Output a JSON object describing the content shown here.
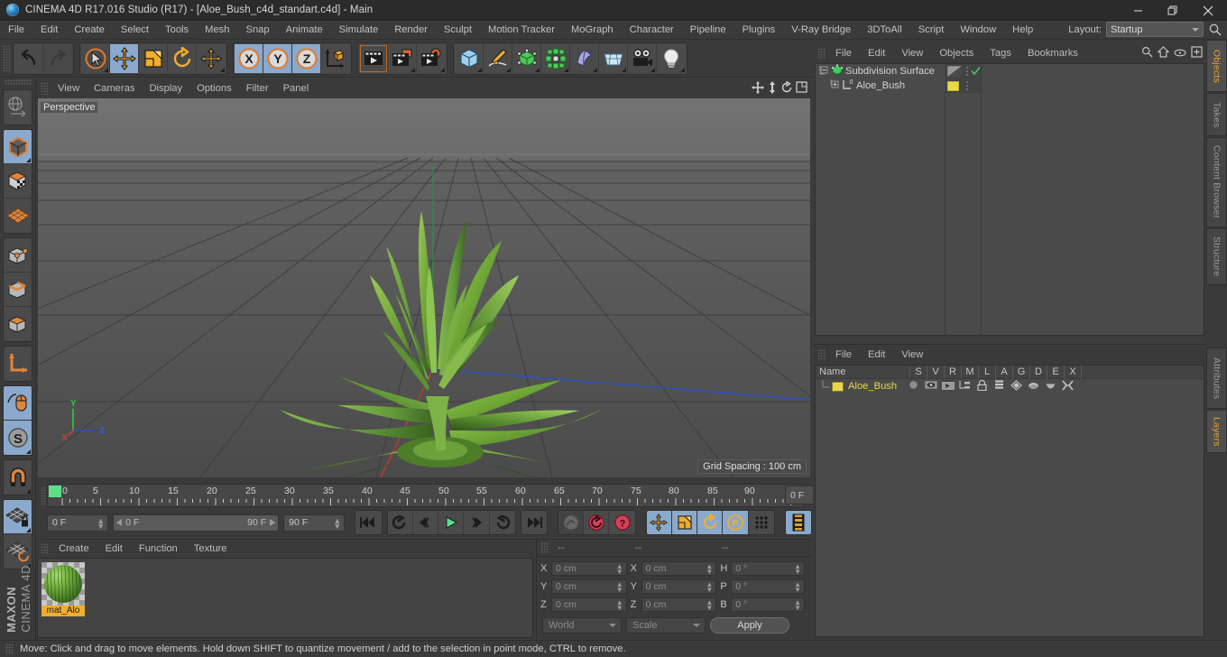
{
  "window": {
    "title": "CINEMA 4D R17.016 Studio (R17) - [Aloe_Bush_c4d_standart.c4d] - Main",
    "minimize_label": "—",
    "maximize_label": "❐",
    "close_label": "✕"
  },
  "menubar": {
    "items": [
      {
        "label": "File"
      },
      {
        "label": "Edit"
      },
      {
        "label": "Create"
      },
      {
        "label": "Select"
      },
      {
        "label": "Tools"
      },
      {
        "label": "Mesh"
      },
      {
        "label": "Snap"
      },
      {
        "label": "Animate"
      },
      {
        "label": "Simulate"
      },
      {
        "label": "Render"
      },
      {
        "label": "Sculpt"
      },
      {
        "label": "Motion Tracker"
      },
      {
        "label": "MoGraph"
      },
      {
        "label": "Character"
      },
      {
        "label": "Pipeline"
      },
      {
        "label": "Plugins"
      },
      {
        "label": "V-Ray Bridge"
      },
      {
        "label": "3DToAll"
      },
      {
        "label": "Script"
      },
      {
        "label": "Window"
      },
      {
        "label": "Help"
      }
    ],
    "layout_label": "Layout:",
    "layout_value": "Startup"
  },
  "toolbar": {
    "groups": [
      {
        "buttons": [
          {
            "name": "undo-icon",
            "selected": false
          },
          {
            "name": "redo-icon",
            "selected": false
          }
        ]
      },
      {
        "buttons": [
          {
            "name": "live-selection-icon",
            "selected": false
          },
          {
            "name": "move-tool-icon",
            "selected": true
          },
          {
            "name": "scale-tool-icon",
            "selected": false
          },
          {
            "name": "rotate-tool-icon",
            "selected": false
          },
          {
            "name": "move-axis-icon",
            "selected": false
          }
        ]
      },
      {
        "buttons": [
          {
            "name": "lock-x-axis-icon",
            "selected": true,
            "label": "X"
          },
          {
            "name": "lock-y-axis-icon",
            "selected": true,
            "label": "Y"
          },
          {
            "name": "lock-z-axis-icon",
            "selected": true,
            "label": "Z"
          },
          {
            "name": "world-object-coordinates-icon",
            "selected": false
          }
        ]
      },
      {
        "buttons": [
          {
            "name": "render-view-icon",
            "selected": false
          },
          {
            "name": "render-to-picture-viewer-icon",
            "selected": false
          },
          {
            "name": "render-settings-icon",
            "selected": false
          }
        ]
      },
      {
        "buttons": [
          {
            "name": "cube-primitive-icon",
            "selected": false
          },
          {
            "name": "spline-pen-icon",
            "selected": false
          },
          {
            "name": "generators-icon",
            "selected": false
          },
          {
            "name": "mograph-icon",
            "selected": false
          },
          {
            "name": "deformers-icon",
            "selected": false
          },
          {
            "name": "scene-floor-icon",
            "selected": false
          },
          {
            "name": "camera-icon",
            "selected": false
          },
          {
            "name": "light-icon",
            "selected": false
          }
        ]
      }
    ]
  },
  "leftbar": {
    "groups": [
      {
        "buttons": [
          {
            "name": "undo-view-icon",
            "selected": false
          }
        ]
      },
      {
        "buttons": [
          {
            "name": "model-mode-icon",
            "selected": true
          },
          {
            "name": "texture-mode-icon",
            "selected": false
          },
          {
            "name": "workplane-mode-icon",
            "selected": false
          }
        ]
      },
      {
        "buttons": [
          {
            "name": "points-mode-icon",
            "selected": false
          },
          {
            "name": "edges-mode-icon",
            "selected": false
          },
          {
            "name": "polygons-mode-icon",
            "selected": false
          }
        ]
      },
      {
        "buttons": [
          {
            "name": "object-axis-mode-icon",
            "selected": false
          }
        ]
      },
      {
        "buttons": [
          {
            "name": "viewport-solo-icon",
            "selected": true
          },
          {
            "name": "enable-snapping-icon",
            "selected": true
          }
        ]
      },
      {
        "buttons": [
          {
            "name": "magnet-tool-icon",
            "selected": false
          }
        ]
      },
      {
        "buttons": [
          {
            "name": "workplane-lock-icon",
            "selected": true
          },
          {
            "name": "workplane-rotate-icon",
            "selected": false
          }
        ]
      }
    ],
    "brand_bold": "MAXON",
    "brand_light": "CINEMA 4D"
  },
  "viewport": {
    "menus": [
      {
        "label": "View"
      },
      {
        "label": "Cameras"
      },
      {
        "label": "Display"
      },
      {
        "label": "Options"
      },
      {
        "label": "Filter"
      },
      {
        "label": "Panel"
      }
    ],
    "nav_icons": [
      "pan-view-icon",
      "dolly-view-icon",
      "rotate-view-icon",
      "maximize-view-icon"
    ],
    "label": "Perspective",
    "grid_spacing": "Grid Spacing : 100 cm",
    "axis": {
      "x": "X",
      "y": "Y",
      "z": "Z"
    }
  },
  "timeline": {
    "tick_labels": [
      "0",
      "5",
      "10",
      "15",
      "20",
      "25",
      "30",
      "35",
      "40",
      "45",
      "50",
      "55",
      "60",
      "65",
      "70",
      "75",
      "80",
      "85",
      "90"
    ],
    "current_frame_right": "0 F",
    "current_frame": "0 F",
    "range_start": "0 F",
    "range_end": "90 F",
    "max_frame": "90 F",
    "buttons": [
      {
        "name": "go-to-start-button",
        "selected": false
      },
      {
        "name": "go-to-previous-key-button",
        "selected": false
      },
      {
        "name": "step-back-button",
        "selected": false
      },
      {
        "name": "play-button",
        "selected": false
      },
      {
        "name": "step-forward-button",
        "selected": false
      },
      {
        "name": "go-to-next-key-button",
        "selected": false
      },
      {
        "name": "go-to-end-button",
        "selected": false
      },
      {
        "name": "record-active-objects-button",
        "selected": false
      },
      {
        "name": "autokeying-button",
        "selected": false
      },
      {
        "name": "keyframe-help-button",
        "selected": false
      },
      {
        "name": "key-position-button",
        "selected": true
      },
      {
        "name": "key-scale-button",
        "selected": true
      },
      {
        "name": "key-rotation-button",
        "selected": true
      },
      {
        "name": "key-parameter-button",
        "selected": true
      },
      {
        "name": "key-point-level-animation-button",
        "selected": false
      },
      {
        "name": "timeline-settings-button",
        "selected": true
      }
    ]
  },
  "materials": {
    "menus": [
      {
        "label": "Create"
      },
      {
        "label": "Edit"
      },
      {
        "label": "Function"
      },
      {
        "label": "Texture"
      }
    ],
    "items": [
      {
        "name": "mat_Alo"
      }
    ]
  },
  "coordinates": {
    "headers": [
      "--",
      "--",
      "--"
    ],
    "rows": [
      {
        "pos_axis": "X",
        "pos_value": "0 cm",
        "size_axis": "X",
        "size_value": "0 cm",
        "rot_axis": "H",
        "rot_value": "0 °"
      },
      {
        "pos_axis": "Y",
        "pos_value": "0 cm",
        "size_axis": "Y",
        "size_value": "0 cm",
        "rot_axis": "P",
        "rot_value": "0 °"
      },
      {
        "pos_axis": "Z",
        "pos_value": "0 cm",
        "size_axis": "Z",
        "size_value": "0 cm",
        "rot_axis": "B",
        "rot_value": "0 °"
      }
    ],
    "coord_system": "World",
    "transform_mode": "Scale",
    "apply_label": "Apply"
  },
  "object_manager": {
    "menus": [
      {
        "label": "File"
      },
      {
        "label": "Edit"
      },
      {
        "label": "View"
      },
      {
        "label": "Objects"
      },
      {
        "label": "Tags"
      },
      {
        "label": "Bookmarks"
      }
    ],
    "icons": [
      "search-icon",
      "home-icon",
      "eye-icon",
      "new-layer-icon"
    ],
    "rows": [
      {
        "label": "Subdivision Surface",
        "depth": 0,
        "icon": "subdivision-surface-icon",
        "expanded": true
      },
      {
        "label": "Aloe_Bush",
        "depth": 1,
        "icon": "polygon-object-icon",
        "expanded": false
      }
    ]
  },
  "layer_manager": {
    "menus": [
      {
        "label": "File"
      },
      {
        "label": "Edit"
      },
      {
        "label": "View"
      }
    ],
    "columns": [
      "Name",
      "S",
      "V",
      "R",
      "M",
      "L",
      "A",
      "G",
      "D",
      "E",
      "X"
    ],
    "rows": [
      {
        "label": "Aloe_Bush",
        "color": "#e7d84a"
      }
    ]
  },
  "vertical_tabs": {
    "top": [
      {
        "label": "Objects",
        "active": true
      },
      {
        "label": "Takes",
        "active": false
      },
      {
        "label": "Content Browser",
        "active": false
      },
      {
        "label": "Structure",
        "active": false
      }
    ],
    "bottom": [
      {
        "label": "Attributes",
        "active": false
      },
      {
        "label": "Layers",
        "active": true
      }
    ]
  },
  "statusbar": {
    "text": "Move: Click and drag to move elements. Hold down SHIFT to quantize movement / add to the selection in point mode, CTRL to remove."
  },
  "colors": {
    "accent_orange": "#f0ad2e",
    "selection_blue": "#8aa9cc",
    "panel_bg": "#3a3a3a",
    "field_bg": "#4a4a4a",
    "axis_x": "#d33a3a",
    "axis_y": "#3ad33a",
    "axis_z": "#3a5ad3"
  }
}
